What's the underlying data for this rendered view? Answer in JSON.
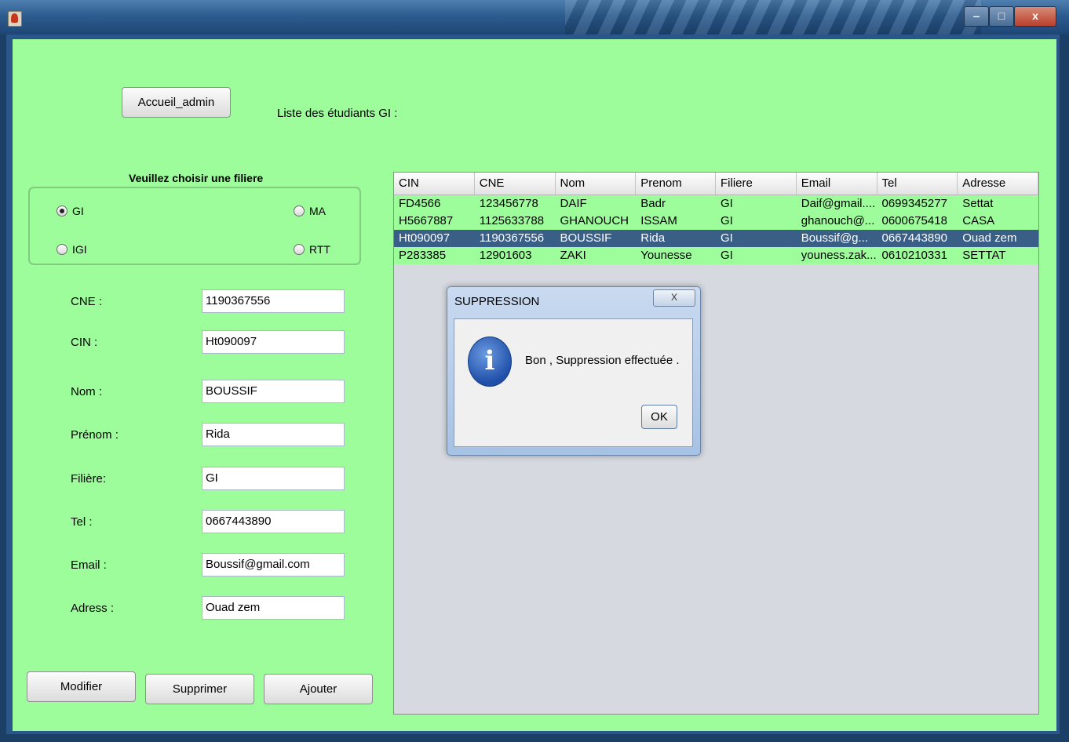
{
  "window": {
    "min_label": "‒",
    "max_label": "□",
    "close_label": "x"
  },
  "header": {
    "accueil_button": "Accueil_admin",
    "list_title": "Liste des étudiants GI :"
  },
  "filiere": {
    "prompt": "Veuillez choisir une filiere",
    "options": [
      {
        "label": "GI",
        "selected": true
      },
      {
        "label": "MA",
        "selected": false
      },
      {
        "label": "IGI",
        "selected": false
      },
      {
        "label": "RTT",
        "selected": false
      }
    ]
  },
  "form": {
    "cne": {
      "label": "CNE :",
      "value": "1190367556"
    },
    "cin": {
      "label": "CIN :",
      "value": "Ht090097"
    },
    "nom": {
      "label": "Nom :",
      "value": "BOUSSIF"
    },
    "prenom": {
      "label": "Prénom :",
      "value": "Rida"
    },
    "filiere": {
      "label": "Filière:",
      "value": "GI"
    },
    "tel": {
      "label": "Tel :",
      "value": "0667443890"
    },
    "email": {
      "label": "Email :",
      "value": "Boussif@gmail.com"
    },
    "adress": {
      "label": "Adress :",
      "value": "Ouad zem"
    }
  },
  "actions": {
    "modifier": "Modifier",
    "supprimer": "Supprimer",
    "ajouter": "Ajouter"
  },
  "table": {
    "columns": [
      "CIN",
      "CNE",
      "Nom",
      "Prenom",
      "Filiere",
      "Email",
      "Tel",
      "Adresse"
    ],
    "rows": [
      [
        "FD4566",
        "123456778",
        "DAIF",
        "Badr",
        "GI",
        "Daif@gmail....",
        "0699345277",
        "Settat"
      ],
      [
        "H5667887",
        "1125633788",
        "GHANOUCH",
        "ISSAM",
        "GI",
        "ghanouch@...",
        "0600675418",
        "CASA"
      ],
      [
        "Ht090097",
        "1190367556",
        "BOUSSIF",
        "Rida",
        "GI",
        "Boussif@g...",
        "0667443890",
        "Ouad zem"
      ],
      [
        "P283385",
        "12901603",
        "ZAKI",
        "Younesse",
        "GI",
        "youness.zak...",
        "0610210331",
        "SETTAT"
      ]
    ],
    "selected_row": 2
  },
  "dialog": {
    "title": "SUPPRESSION",
    "close_label": "X",
    "icon_glyph": "i",
    "message": "Bon , Suppression effectuée .",
    "ok_label": "OK"
  }
}
